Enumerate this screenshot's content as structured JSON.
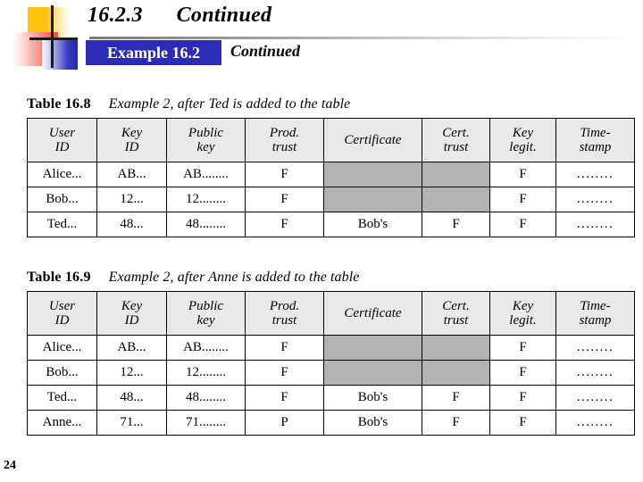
{
  "slide": {
    "title": "16.2.3      Continued",
    "page_number": "24",
    "example_band_label": "Example 16.2",
    "example_continued_label": "Continued",
    "accent_blue": "#2B2BB8",
    "logo_yellow": "#FFC20E",
    "logo_red": "#F4463C",
    "logo_blue": "#3B3BC4"
  },
  "columns": [
    {
      "line1": "User",
      "line2": "ID"
    },
    {
      "line1": "Key",
      "line2": "ID"
    },
    {
      "line1": "Public",
      "line2": "key"
    },
    {
      "line1": "Prod.",
      "line2": "trust"
    },
    {
      "line1": "",
      "line2": "Certificate"
    },
    {
      "line1": "Cert.",
      "line2": "trust"
    },
    {
      "line1": "Key",
      "line2": "legit."
    },
    {
      "line1": "Time-",
      "line2": "stamp"
    }
  ],
  "tables": [
    {
      "caption_label": "Table 16.8",
      "caption_text": "Example 2, after Ted is added to the table",
      "rows": [
        {
          "user": "Alice...",
          "key_id": "AB...",
          "public_key": "AB........",
          "prod_trust": "F",
          "certificate": "",
          "cert_trust": "",
          "key_legit": "F",
          "timestamp": "........",
          "certificate_shaded": true,
          "cert_trust_shaded": true
        },
        {
          "user": "Bob...",
          "key_id": "12...",
          "public_key": "12........",
          "prod_trust": "F",
          "certificate": "",
          "cert_trust": "",
          "key_legit": "F",
          "timestamp": "........",
          "certificate_shaded": true,
          "cert_trust_shaded": true
        },
        {
          "user": "Ted...",
          "key_id": "48...",
          "public_key": "48........",
          "prod_trust": "F",
          "certificate": "Bob's",
          "cert_trust": "F",
          "key_legit": "F",
          "timestamp": "........",
          "certificate_shaded": false,
          "cert_trust_shaded": false
        }
      ]
    },
    {
      "caption_label": "Table 16.9",
      "caption_text": "Example 2, after Anne is added to the table",
      "rows": [
        {
          "user": "Alice...",
          "key_id": "AB...",
          "public_key": "AB........",
          "prod_trust": "F",
          "certificate": "",
          "cert_trust": "",
          "key_legit": "F",
          "timestamp": "........",
          "certificate_shaded": true,
          "cert_trust_shaded": true
        },
        {
          "user": "Bob...",
          "key_id": "12...",
          "public_key": "12........",
          "prod_trust": "F",
          "certificate": "",
          "cert_trust": "",
          "key_legit": "F",
          "timestamp": "........",
          "certificate_shaded": true,
          "cert_trust_shaded": true
        },
        {
          "user": "Ted...",
          "key_id": "48...",
          "public_key": "48........",
          "prod_trust": "F",
          "certificate": "Bob's",
          "cert_trust": "F",
          "key_legit": "F",
          "timestamp": "........",
          "certificate_shaded": false,
          "cert_trust_shaded": false
        },
        {
          "user": "Anne...",
          "key_id": "71...",
          "public_key": "71........",
          "prod_trust": "P",
          "certificate": "Bob's",
          "cert_trust": "F",
          "key_legit": "F",
          "timestamp": "........",
          "certificate_shaded": false,
          "cert_trust_shaded": false
        }
      ]
    }
  ]
}
